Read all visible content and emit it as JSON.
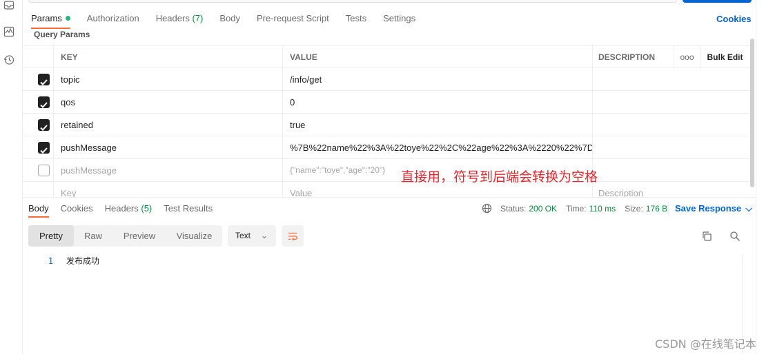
{
  "request_tabs": [
    {
      "label": "Params",
      "active": true,
      "has_dot": true
    },
    {
      "label": "Authorization"
    },
    {
      "label": "Headers",
      "count": "(7)"
    },
    {
      "label": "Body"
    },
    {
      "label": "Pre-request Script"
    },
    {
      "label": "Tests"
    },
    {
      "label": "Settings"
    }
  ],
  "cookies_link": "Cookies",
  "section_label": "Query Params",
  "params_table": {
    "headers": {
      "key": "KEY",
      "value": "VALUE",
      "description": "DESCRIPTION",
      "more": "ooo",
      "bulk_edit": "Bulk Edit"
    },
    "rows": [
      {
        "checked": true,
        "key": "topic",
        "value": "/info/get",
        "description": ""
      },
      {
        "checked": true,
        "key": "qos",
        "value": "0",
        "description": ""
      },
      {
        "checked": true,
        "key": "retained",
        "value": "true",
        "description": ""
      },
      {
        "checked": true,
        "key": "pushMessage",
        "value": "%7B%22name%22%3A%22toye%22%2C%22age%22%3A%2220%22%7D",
        "description": ""
      },
      {
        "checked": false,
        "key": "pushMessage",
        "value": "{\"name\":\"toye\",\"age\":\"20\"}",
        "description": ""
      }
    ],
    "placeholder": {
      "key": "Key",
      "value": "Value",
      "description": "Description"
    }
  },
  "annotation": "直接用，符号到后端会转换为空格",
  "response": {
    "tabs": [
      {
        "label": "Body",
        "active": true
      },
      {
        "label": "Cookies"
      },
      {
        "label": "Headers",
        "count": "(5)"
      },
      {
        "label": "Test Results"
      }
    ],
    "status_label": "Status:",
    "status_value": "200 OK",
    "time_label": "Time:",
    "time_value": "110 ms",
    "size_label": "Size:",
    "size_value": "176 B",
    "save_response": "Save Response",
    "view_options": [
      "Pretty",
      "Raw",
      "Preview",
      "Visualize"
    ],
    "active_view": "Pretty",
    "format": "Text",
    "body_lines": [
      {
        "no": "1",
        "text": "发布成功"
      }
    ]
  },
  "icons": {
    "left_bar": [
      "inbox-icon",
      "activity-icon",
      "history-icon"
    ],
    "toolbar": [
      "wrap-lines-icon",
      "copy-icon",
      "search-icon",
      "globe-icon"
    ]
  },
  "watermark": "CSDN @在线笔记本",
  "colors": {
    "accent": "#ff6c37",
    "link": "#0265d2",
    "success": "#0b8a3e",
    "annotation": "#e8262d"
  }
}
